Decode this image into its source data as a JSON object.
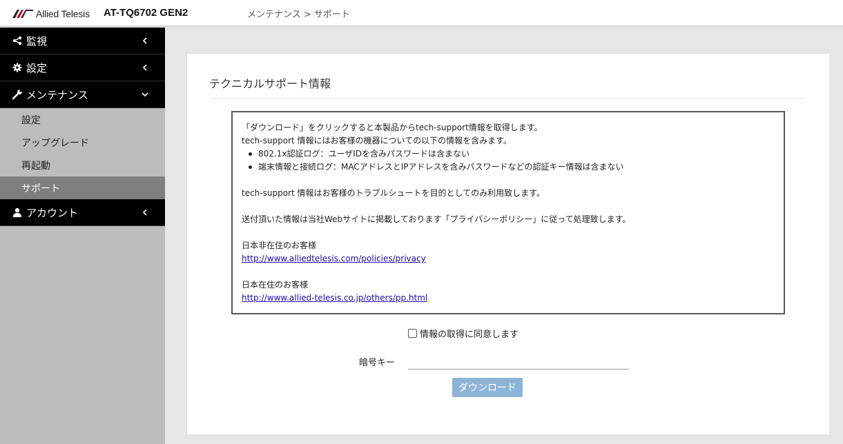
{
  "header": {
    "logo_text": "Allied Telesis",
    "model": "AT-TQ6702 GEN2",
    "breadcrumb": "メンテナンス > サポート"
  },
  "sidebar": {
    "items": [
      {
        "label": "監視",
        "icon": "share-icon",
        "expanded": false
      },
      {
        "label": "設定",
        "icon": "gear-icon",
        "expanded": false
      },
      {
        "label": "メンテナンス",
        "icon": "wrench-icon",
        "expanded": true
      },
      {
        "label": "アカウント",
        "icon": "user-icon",
        "expanded": false
      }
    ],
    "maintenance_children": [
      {
        "label": "設定",
        "active": false
      },
      {
        "label": "アップグレード",
        "active": false
      },
      {
        "label": "再起動",
        "active": false
      },
      {
        "label": "サポート",
        "active": true
      }
    ]
  },
  "main": {
    "title": "テクニカルサポート情報",
    "info": {
      "line1": "「ダウンロード」をクリックすると本製品からtech-support情報を取得します。",
      "line2": "tech-support 情報にはお客様の機器についての以下の情報を含みます。",
      "bullets": [
        "802.1x認証ログ：ユーザIDを含みパスワードは含まない",
        "端末情報と接続ログ：MACアドレスとIPアドレスを含みパスワードなどの認証キー情報は含まない"
      ],
      "purpose": "tech-support 情報はお客様のトラブルシュートを目的としてのみ利用致します。",
      "policy": "送付頂いた情報は当社Webサイトに掲載しております「プライバシーポリシー」に従って処理致します。",
      "non_japan_label": "日本非在住のお客様",
      "non_japan_link": "http://www.alliedtelesis.com/policies/privacy",
      "japan_label": "日本在住のお客様",
      "japan_link": "http://www.allied-telesis.co.jp/others/pp.html"
    },
    "consent_label": "情報の取得に同意します",
    "consent_checked": false,
    "key_label": "暗号キー",
    "key_value": "",
    "download_label": "ダウンロード"
  },
  "colors": {
    "nav_bg": "#000000",
    "active_sub_bg": "#7f7f7f",
    "sidebar_bg": "#bcbcbc",
    "button_bg": "#8db4d6",
    "link": "#1a0dab"
  }
}
